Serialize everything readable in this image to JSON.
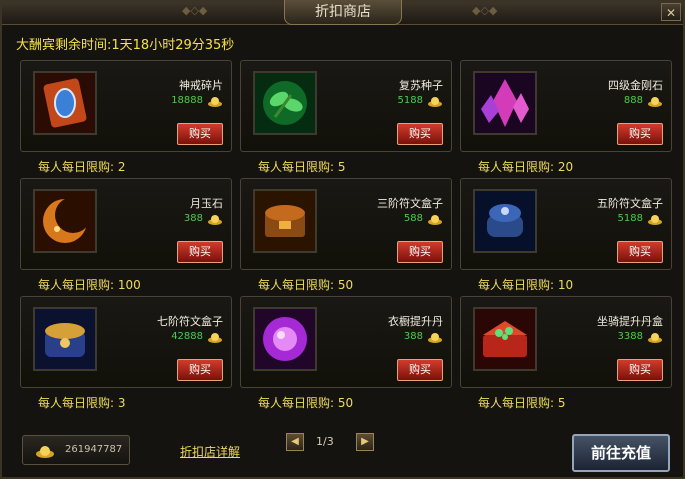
{
  "window": {
    "title": "折扣商店",
    "close_label": "✕"
  },
  "timer": {
    "text": "大酬宾剩余时间:1天18小时29分35秒"
  },
  "items": [
    {
      "name": "神戒碎片",
      "price": "18888",
      "buy_label": "购买",
      "limit": "每人每日限购: 2",
      "icon": "ring-shard-icon"
    },
    {
      "name": "复苏种子",
      "price": "5188",
      "buy_label": "购买",
      "limit": "每人每日限购: 5",
      "icon": "seed-icon"
    },
    {
      "name": "四级金刚石",
      "price": "888",
      "buy_label": "购买",
      "limit": "每人每日限购: 20",
      "icon": "crystal-icon"
    },
    {
      "name": "月玉石",
      "price": "388",
      "buy_label": "购买",
      "limit": "每人每日限购: 100",
      "icon": "moon-jade-icon"
    },
    {
      "name": "三阶符文盒子",
      "price": "588",
      "buy_label": "购买",
      "limit": "每人每日限购: 50",
      "icon": "rune-box-3-icon"
    },
    {
      "name": "五阶符文盒子",
      "price": "5188",
      "buy_label": "购买",
      "limit": "每人每日限购: 10",
      "icon": "rune-box-5-icon"
    },
    {
      "name": "七阶符文盒子",
      "price": "42888",
      "buy_label": "购买",
      "limit": "每人每日限购: 3",
      "icon": "rune-box-7-icon"
    },
    {
      "name": "衣橱提升丹",
      "price": "388",
      "buy_label": "购买",
      "limit": "每人每日限购: 50",
      "icon": "wardrobe-pill-icon"
    },
    {
      "name": "坐骑提升丹盒",
      "price": "3388",
      "buy_label": "购买",
      "limit": "每人每日限购: 5",
      "icon": "mount-pill-box-icon"
    }
  ],
  "footer": {
    "gold_amount": "261947787",
    "detail_link": "折扣店详解",
    "page_indicator": "1/3",
    "prev_label": "◀",
    "next_label": "▶",
    "recharge_label": "前往充值"
  },
  "colors": {
    "accent_gold": "#f4e14a",
    "price_green": "#4ec94e",
    "buy_red": "#c02a1e"
  }
}
